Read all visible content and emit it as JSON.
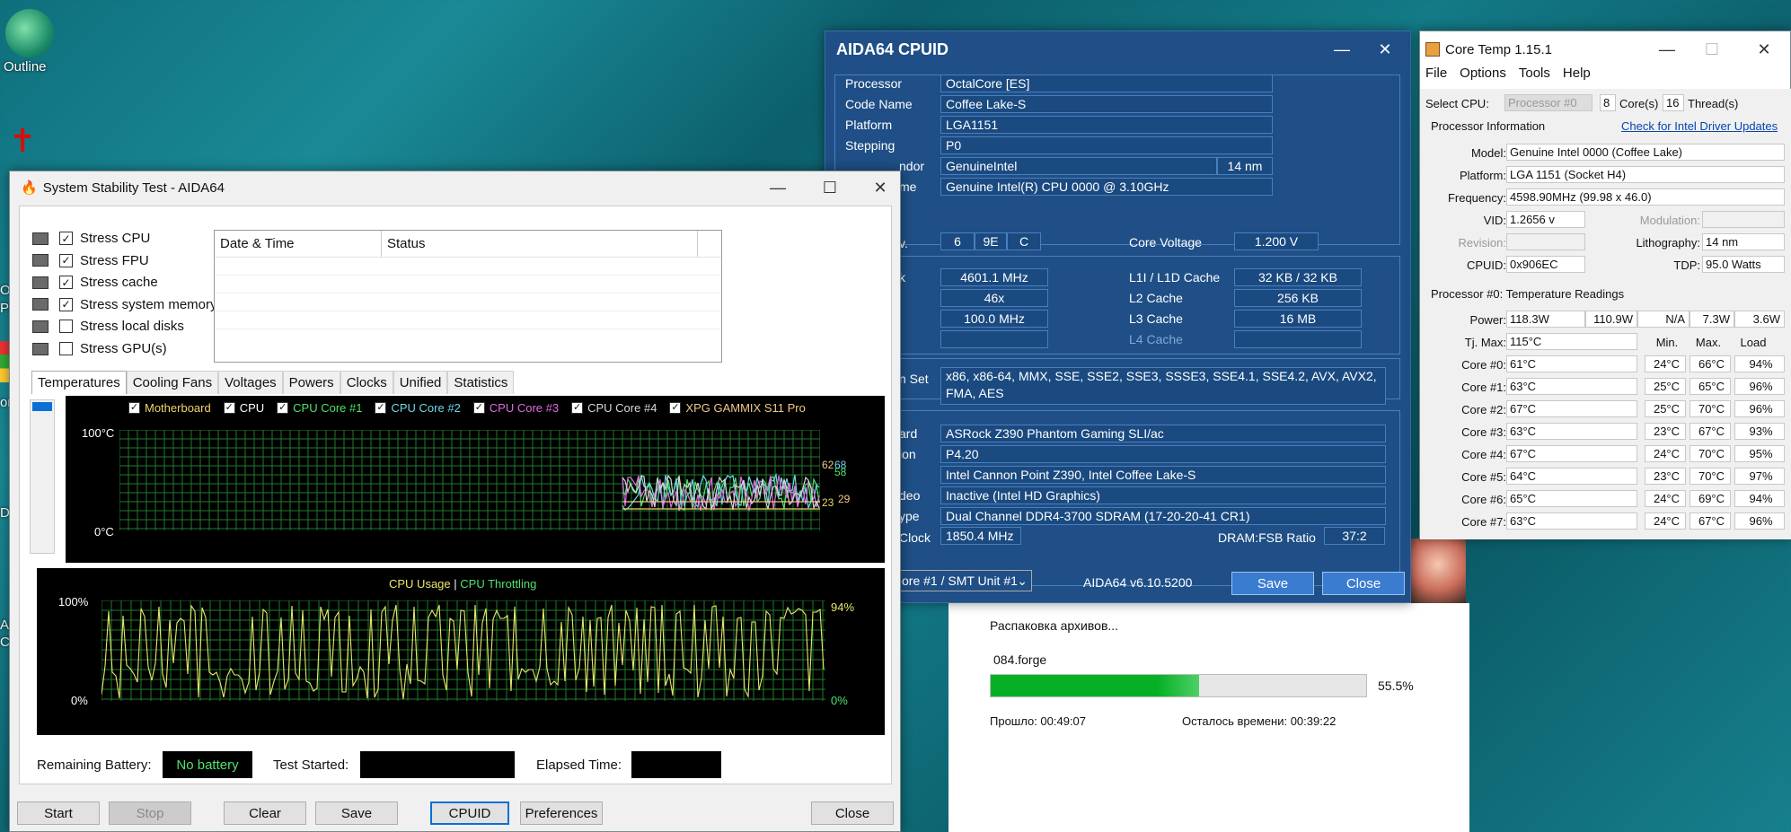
{
  "desktop": {
    "icons": [
      {
        "label": "Outline"
      }
    ],
    "edge_labels": [
      "Or",
      "Pi",
      "or",
      "DI",
      "As",
      "Cr"
    ]
  },
  "sst": {
    "title": "System Stability Test - AIDA64",
    "stress": [
      {
        "label": "Stress CPU",
        "checked": true
      },
      {
        "label": "Stress FPU",
        "checked": true
      },
      {
        "label": "Stress cache",
        "checked": true
      },
      {
        "label": "Stress system memory",
        "checked": true
      },
      {
        "label": "Stress local disks",
        "checked": false
      },
      {
        "label": "Stress GPU(s)",
        "checked": false
      }
    ],
    "log_headers": [
      "Date & Time",
      "Status"
    ],
    "tabs": [
      "Temperatures",
      "Cooling Fans",
      "Voltages",
      "Powers",
      "Clocks",
      "Unified",
      "Statistics"
    ],
    "temp_legend": [
      {
        "label": "Motherboard",
        "color": "#f2d36b"
      },
      {
        "label": "CPU",
        "color": "#ffffff"
      },
      {
        "label": "CPU Core #1",
        "color": "#4de36b"
      },
      {
        "label": "CPU Core #2",
        "color": "#6fd7e8"
      },
      {
        "label": "CPU Core #3",
        "color": "#e26be0"
      },
      {
        "label": "CPU Core #4",
        "color": "#d8d8d8"
      },
      {
        "label": "XPG GAMMIX S11 Pro",
        "color": "#f2c98a"
      }
    ],
    "temp_axis": {
      "top": "100°C",
      "bottom": "0°C"
    },
    "temp_right_labels": {
      "a": "62",
      "b": "68",
      "c": "58",
      "d": "23",
      "e": "29"
    },
    "usage_title": {
      "a": "CPU Usage",
      "sep": "|",
      "b": "CPU Throttling"
    },
    "usage_axis": {
      "top": "100%",
      "bottom": "0%",
      "right_top": "94%",
      "right_bottom": "0%"
    },
    "footer": {
      "battery_label": "Remaining Battery:",
      "battery_value": "No battery",
      "started_label": "Test Started:",
      "elapsed_label": "Elapsed Time:"
    },
    "buttons": {
      "start": "Start",
      "stop": "Stop",
      "clear": "Clear",
      "save": "Save",
      "cpuid": "CPUID",
      "prefs": "Preferences",
      "close": "Close"
    }
  },
  "cpuid": {
    "title": "AIDA64 CPUID",
    "rows1": [
      {
        "label": "Processor",
        "value": "OctalCore  [ES]"
      },
      {
        "label": "Code Name",
        "value": "Coffee Lake-S"
      },
      {
        "label": "Platform",
        "value": "LGA1151"
      },
      {
        "label": "Stepping",
        "value": "P0"
      },
      {
        "label": "ndor",
        "value": "GenuineIntel",
        "extra": "14 nm"
      },
      {
        "label": "me",
        "value": "Genuine Intel(R) CPU 0000 @ 3.10GHz"
      }
    ],
    "ver": {
      "label": "v.",
      "a": "6",
      "b": "9E",
      "c": "C"
    },
    "voltage": {
      "label": "Core Voltage",
      "value": "1.200 V"
    },
    "clocks": [
      {
        "label": "k",
        "value": "4601.1 MHz"
      },
      {
        "label": "",
        "value": "46x"
      },
      {
        "label": "",
        "value": "100.0 MHz"
      },
      {
        "label": "",
        "value": ""
      }
    ],
    "caches": [
      {
        "label": "L1I / L1D Cache",
        "value": "32 KB / 32 KB"
      },
      {
        "label": "L2 Cache",
        "value": "256 KB"
      },
      {
        "label": "L3 Cache",
        "value": "16 MB"
      },
      {
        "label": "L4 Cache",
        "value": ""
      }
    ],
    "iset": {
      "label": "n Set",
      "value": "x86, x86-64, MMX, SSE, SSE2, SSE3, SSSE3, SSE4.1, SSE4.2, AVX, AVX2, FMA, AES"
    },
    "rows2": [
      {
        "label": "ard",
        "value": "ASRock Z390 Phantom Gaming SLI/ac"
      },
      {
        "label": "ion",
        "value": "P4.20"
      },
      {
        "label": "",
        "value": "Intel Cannon Point Z390, Intel Coffee Lake-S"
      },
      {
        "label": "deo",
        "value": "Inactive  (Intel HD Graphics)"
      },
      {
        "label": "ype",
        "value": "Dual Channel DDR4-3700 SDRAM  (17-20-20-41 CR1)"
      }
    ],
    "memclock": {
      "label": "Clock",
      "value": "1850.4 MHz",
      "ratio_label": "DRAM:FSB Ratio",
      "ratio": "37:2"
    },
    "core_select": "ore #1 / SMT Unit #1",
    "version": "AIDA64 v6.10.5200",
    "save": "Save",
    "close": "Close"
  },
  "coretemp": {
    "title": "Core Temp 1.15.1",
    "menu": [
      "File",
      "Options",
      "Tools",
      "Help"
    ],
    "select_label": "Select CPU:",
    "select_value": "Processor #0",
    "cores": "8",
    "cores_label": "Core(s)",
    "threads": "16",
    "threads_label": "Thread(s)",
    "info_label": "Processor Information",
    "driver_link": "Check for Intel Driver Updates",
    "model_label": "Model:",
    "model": "Genuine Intel 0000 (Coffee Lake)",
    "platform_label": "Platform:",
    "platform": "LGA 1151 (Socket H4)",
    "freq_label": "Frequency:",
    "freq": "4598.90MHz (99.98 x 46.0)",
    "vid_label": "VID:",
    "vid": "1.2656 v",
    "mod_label": "Modulation:",
    "rev_label": "Revision:",
    "litho_label": "Lithography:",
    "litho": "14 nm",
    "cpuid_label": "CPUID:",
    "cpuid": "0x906EC",
    "tdp_label": "TDP:",
    "tdp": "95.0 Watts",
    "readings_label": "Processor #0: Temperature Readings",
    "power_label": "Power:",
    "power": [
      "118.3W",
      "110.9W",
      "N/A",
      "7.3W",
      "3.6W"
    ],
    "tj_label": "Tj. Max:",
    "tj": "115°C",
    "col_min": "Min.",
    "col_max": "Max.",
    "col_load": "Load",
    "cores_rows": [
      {
        "label": "Core #0:",
        "t": "61°C",
        "min": "24°C",
        "max": "66°C",
        "load": "94%"
      },
      {
        "label": "Core #1:",
        "t": "63°C",
        "min": "25°C",
        "max": "65°C",
        "load": "96%"
      },
      {
        "label": "Core #2:",
        "t": "67°C",
        "min": "25°C",
        "max": "70°C",
        "load": "96%"
      },
      {
        "label": "Core #3:",
        "t": "63°C",
        "min": "23°C",
        "max": "67°C",
        "load": "93%"
      },
      {
        "label": "Core #4:",
        "t": "67°C",
        "min": "24°C",
        "max": "70°C",
        "load": "95%"
      },
      {
        "label": "Core #5:",
        "t": "64°C",
        "min": "23°C",
        "max": "70°C",
        "load": "97%"
      },
      {
        "label": "Core #6:",
        "t": "65°C",
        "min": "24°C",
        "max": "69°C",
        "load": "94%"
      },
      {
        "label": "Core #7:",
        "t": "63°C",
        "min": "24°C",
        "max": "67°C",
        "load": "96%"
      }
    ]
  },
  "unpack": {
    "title": "Распаковка архивов...",
    "file": "084.forge",
    "progress": 0.555,
    "percent": "55.5%",
    "elapsed": "Прошло:   00:49:07",
    "remaining": "Осталось времени:   00:39:22"
  }
}
